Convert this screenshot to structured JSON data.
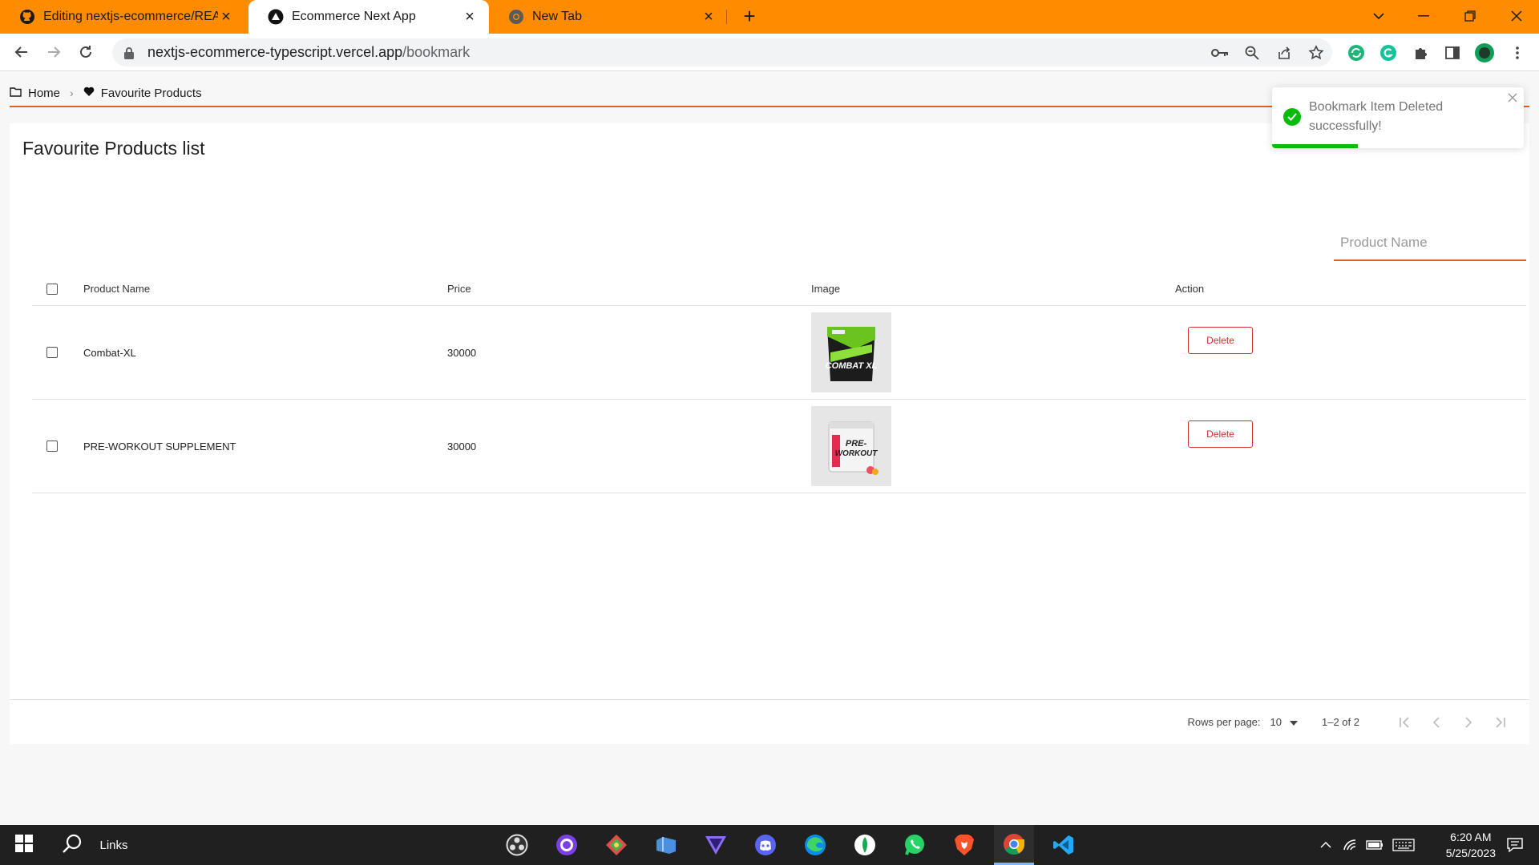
{
  "browser": {
    "tabs": [
      {
        "title": "Editing nextjs-ecommerce/READM",
        "icon": "github-icon",
        "active": false
      },
      {
        "title": "Ecommerce Next App",
        "icon": "vercel-triangle-icon",
        "active": true
      },
      {
        "title": "New Tab",
        "icon": "chrome-icon",
        "active": false
      }
    ],
    "url_host": "nextjs-ecommerce-typescript.vercel.app",
    "url_path": "/bookmark"
  },
  "breadcrumb": {
    "home": "Home",
    "current": "Favourite Products"
  },
  "page": {
    "title": "Favourite Products list",
    "search_placeholder": "Product Name"
  },
  "table": {
    "columns": [
      "Product Name",
      "Price",
      "Image",
      "Action"
    ],
    "rows": [
      {
        "name": "Combat-XL",
        "price": "30000",
        "image": "combat-xl-product-image",
        "action": "Delete"
      },
      {
        "name": "PRE-WORKOUT SUPPLEMENT",
        "price": "30000",
        "image": "pre-workout-product-image",
        "action": "Delete"
      }
    ]
  },
  "pagination": {
    "rows_label": "Rows per page:",
    "rows_value": "10",
    "range": "1–2 of 2"
  },
  "toast": {
    "message": "Bookmark Item Deleted successfully!",
    "progress": 0.34
  },
  "taskbar": {
    "search_label": "Links",
    "time": "6:20 AM",
    "date": "5/25/2023"
  },
  "colors": {
    "tab_strip": "#ff8c00",
    "accent": "#e0601f",
    "danger": "#d32f2f",
    "success": "#07bc0c"
  }
}
